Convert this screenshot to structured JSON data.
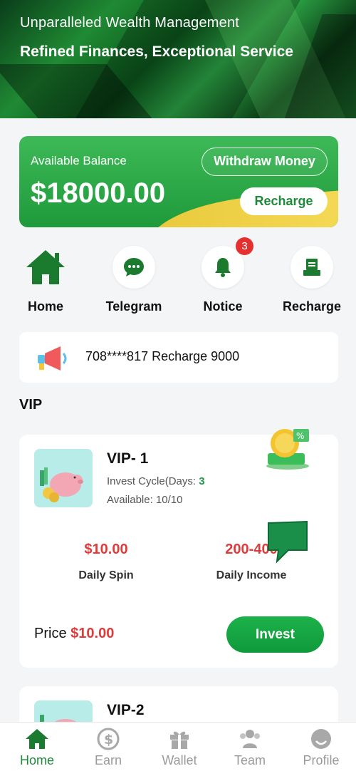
{
  "header": {
    "subtitle": "Unparalleled Wealth Management",
    "title": "Refined Finances, Exceptional Service"
  },
  "balance": {
    "label": "Available Balance",
    "value": "$18000.00",
    "withdraw_label": "Withdraw Money",
    "recharge_label": "Recharge"
  },
  "quick_actions": [
    {
      "label": "Home",
      "icon": "home-icon"
    },
    {
      "label": "Telegram",
      "icon": "chat-icon"
    },
    {
      "label": "Notice",
      "icon": "bell-icon",
      "badge": "3"
    },
    {
      "label": "Recharge",
      "icon": "wallet-icon"
    }
  ],
  "notice": {
    "text": "708****817 Recharge 9000"
  },
  "section_title": "VIP",
  "plans": [
    {
      "name": "VIP- 1",
      "cycle_label": "Invest Cycle(Days:",
      "cycle_days": "3",
      "available": "Available: 10/10",
      "daily_spin_value": "$10.00",
      "daily_spin_label": "Daily Spin",
      "daily_income_value": "200-400",
      "daily_income_label": "Daily Income",
      "price_label": "Price",
      "price_value": "$10.00",
      "invest_label": "Invest"
    },
    {
      "name": "VIP-2"
    }
  ],
  "tabbar": [
    {
      "label": "Home",
      "icon": "home-icon",
      "active": true
    },
    {
      "label": "Earn",
      "icon": "dollar-icon"
    },
    {
      "label": "Wallet",
      "icon": "gift-icon"
    },
    {
      "label": "Team",
      "icon": "team-icon"
    },
    {
      "label": "Profile",
      "icon": "profile-icon"
    }
  ],
  "colors": {
    "brand_green": "#1e8a3b",
    "accent_red": "#e03b3b",
    "badge_red": "#e53030"
  }
}
